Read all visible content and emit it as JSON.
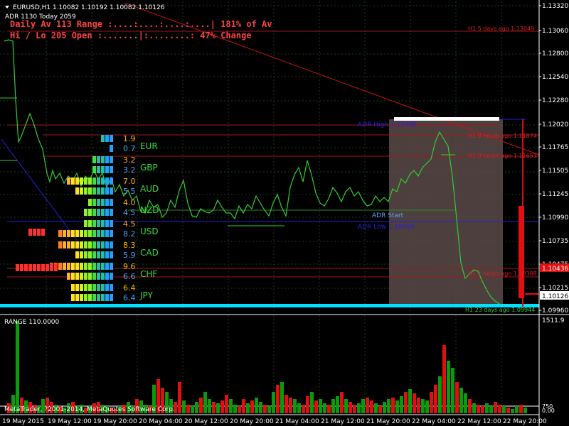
{
  "header": {
    "symbol_line": "EURUSD,H1  1.10082 1.10192 1.10082 1.10126",
    "adr_line": "ADR 1130  Today 2059",
    "daily_line": "Daily Av 113  Range :....:....:....:....|  181% of Av",
    "hilo_line": "Hi / Lo 205  Open :.......|:........:  47% Change"
  },
  "annotations": {
    "hl5": "H1 5 days ago 1.13049",
    "hl9a": "H1 9 hours ago 1.11874",
    "hl9b": "H1 9 hours ago 1.11653",
    "hl1": "H1 1 hours ago 1.10388",
    "hl23": "H1 23 days ago 1.09944",
    "adr_high": "ADR High 1.12080",
    "adr_start": "ADR Start",
    "adr_low": "ADR Low 1.10960"
  },
  "price_axis": [
    "1.13320",
    "1.13060",
    "1.12800",
    "1.12540",
    "1.12280",
    "1.12020",
    "1.11765",
    "1.11505",
    "1.11245",
    "1.10990",
    "1.10735",
    "1.10475",
    "1.10215",
    "1.09960"
  ],
  "price_badges": {
    "red": "1.10436",
    "white": "1.10126"
  },
  "currencies": [
    {
      "name": "EUR",
      "top": "1.9",
      "bottom": "0.7",
      "name_color": "#3cdc3c"
    },
    {
      "name": "GBP",
      "top": "3.2",
      "bottom": "3.2",
      "name_color": "#3cdc3c"
    },
    {
      "name": "AUD",
      "top": "7.0",
      "bottom": "5.5",
      "name_color": "#3cdc3c"
    },
    {
      "name": "NZD",
      "top": "4.0",
      "bottom": "4.5",
      "name_color": "#3cdc3c"
    },
    {
      "name": "USD",
      "top": "4.5",
      "bottom": "8.2",
      "name_color": "#3cdc3c"
    },
    {
      "name": "CAD",
      "top": "8.3",
      "bottom": "5.9",
      "name_color": "#3cdc3c"
    },
    {
      "name": "CHF",
      "top": "9.6",
      "bottom": "6.6",
      "name_color": "#3cdc3c"
    },
    {
      "name": "JPY",
      "top": "6.4",
      "bottom": "6.4",
      "name_color": "#3cdc3c"
    }
  ],
  "indicator": {
    "label": "RANGE 110.0000",
    "axis_top": "1511.9",
    "axis_mid": "750",
    "axis_bottom": "0.00",
    "copyright": "MetaTrader, ?2001-2014, MetaQuotes Software Corp."
  },
  "time_axis": [
    "19 May 2015",
    "19 May 12:00",
    "19 May 20:00",
    "20 May 04:00",
    "20 May 12:00",
    "20 May 20:00",
    "21 May 04:00",
    "21 May 12:00",
    "21 May 20:00",
    "22 May 04:00",
    "22 May 12:00",
    "22 May 20:00"
  ],
  "colors": {
    "grid": "#1e3a1e",
    "price_line": "#32cd32",
    "trend_red": "#d01010",
    "trend_blue": "#2020e0",
    "cyan": "#00e0ff",
    "box": "#5a4a48",
    "text_orange": "#ff4040",
    "label_yellow": "#ffb000",
    "label_blue": "#4aa0ff"
  }
}
